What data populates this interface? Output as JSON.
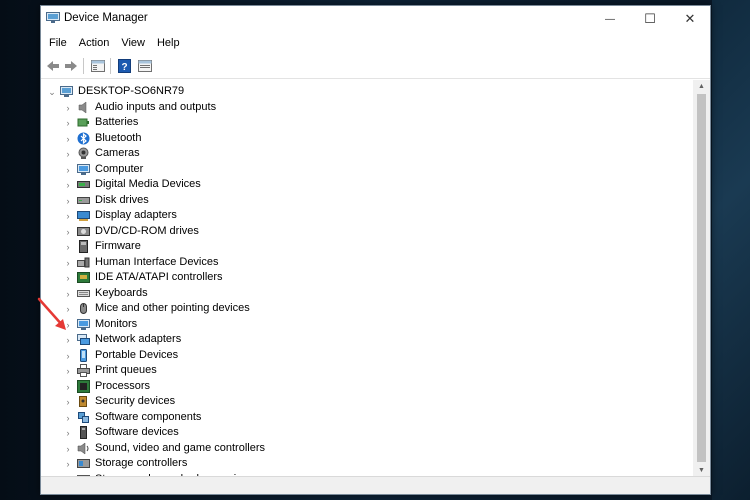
{
  "window": {
    "title": "Device Manager",
    "controls": {
      "minimize": "—",
      "maximize": "☐",
      "close": "✕"
    }
  },
  "menu": [
    "File",
    "Action",
    "View",
    "Help"
  ],
  "toolbar": {
    "buttons": [
      "back-icon",
      "forward-icon",
      "properties-icon",
      "help-icon",
      "view-icon"
    ]
  },
  "tree": {
    "root": {
      "label": "DESKTOP-SO6NR79",
      "icon": "computer-icon",
      "expanded": true
    },
    "categories": [
      {
        "label": "Audio inputs and outputs",
        "icon": "speaker-icon"
      },
      {
        "label": "Batteries",
        "icon": "battery-icon"
      },
      {
        "label": "Bluetooth",
        "icon": "bluetooth-icon"
      },
      {
        "label": "Cameras",
        "icon": "camera-icon"
      },
      {
        "label": "Computer",
        "icon": "monitor-icon"
      },
      {
        "label": "Digital Media Devices",
        "icon": "media-icon"
      },
      {
        "label": "Disk drives",
        "icon": "disk-icon"
      },
      {
        "label": "Display adapters",
        "icon": "display-adapter-icon"
      },
      {
        "label": "DVD/CD-ROM drives",
        "icon": "dvd-icon"
      },
      {
        "label": "Firmware",
        "icon": "firmware-icon"
      },
      {
        "label": "Human Interface Devices",
        "icon": "hid-icon"
      },
      {
        "label": "IDE ATA/ATAPI controllers",
        "icon": "ide-icon"
      },
      {
        "label": "Keyboards",
        "icon": "keyboard-icon"
      },
      {
        "label": "Mice and other pointing devices",
        "icon": "mouse-icon"
      },
      {
        "label": "Monitors",
        "icon": "monitor-icon"
      },
      {
        "label": "Network adapters",
        "icon": "network-icon"
      },
      {
        "label": "Portable Devices",
        "icon": "portable-icon"
      },
      {
        "label": "Print queues",
        "icon": "printer-icon"
      },
      {
        "label": "Processors",
        "icon": "processor-icon"
      },
      {
        "label": "Security devices",
        "icon": "security-icon"
      },
      {
        "label": "Software components",
        "icon": "software-component-icon"
      },
      {
        "label": "Software devices",
        "icon": "software-device-icon"
      },
      {
        "label": "Sound, video and game controllers",
        "icon": "sound-icon"
      },
      {
        "label": "Storage controllers",
        "icon": "storage-icon"
      },
      {
        "label": "Storage volume shadow copies",
        "icon": "storage-shadow-icon"
      }
    ]
  },
  "annotation": {
    "icon": "red-arrow-icon",
    "color": "#e53935"
  },
  "colors": {
    "selection": "#cce8ff",
    "window_border": "#7a8a99"
  }
}
